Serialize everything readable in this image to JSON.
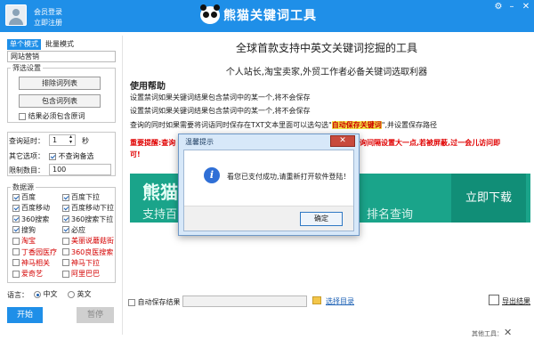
{
  "titlebar": {
    "login": "会员登录",
    "register": "立即注册",
    "app_title": "熊猫关键词工具",
    "controls": {
      "settings": "⚙",
      "minimize": "–",
      "close": "✕"
    }
  },
  "sidebar": {
    "tabs": [
      "单个模式",
      "批量模式"
    ],
    "keyword_input": "网站营销",
    "filter_group": {
      "label": "筛选设置",
      "exclude_button": "排除词列表",
      "include_button": "包含词列表",
      "must_include_label": "结果必须包含原词"
    },
    "interval_label": "查询延时：",
    "interval_value": "1",
    "interval_unit": "秒",
    "other_label": "其它选项：",
    "no_repeat_label": "不查询备选",
    "limit_label": "限制数目：",
    "limit_value": "100",
    "datasource": {
      "label": "数据源",
      "items": [
        {
          "label": "百度",
          "checked": true,
          "red": false
        },
        {
          "label": "百度下拉",
          "checked": true,
          "red": false
        },
        {
          "label": "百度移动",
          "checked": true,
          "red": false
        },
        {
          "label": "百度移动下拉",
          "checked": true,
          "red": false
        },
        {
          "label": "360搜索",
          "checked": true,
          "red": false
        },
        {
          "label": "360搜索下拉",
          "checked": true,
          "red": false
        },
        {
          "label": "搜狗",
          "checked": true,
          "red": false
        },
        {
          "label": "必应",
          "checked": true,
          "red": false
        },
        {
          "label": "淘宝",
          "checked": false,
          "red": true
        },
        {
          "label": "美丽说蘑菇街",
          "checked": false,
          "red": true
        },
        {
          "label": "丁香园医疗",
          "checked": false,
          "red": true
        },
        {
          "label": "360良医搜索",
          "checked": false,
          "red": true
        },
        {
          "label": "神马相关",
          "checked": false,
          "red": true
        },
        {
          "label": "神马下拉",
          "checked": false,
          "red": true
        },
        {
          "label": "爱奇艺",
          "checked": false,
          "red": true
        },
        {
          "label": "阿里巴巴",
          "checked": false,
          "red": true
        }
      ]
    },
    "language_label": "语言：",
    "lang_cn": "中文",
    "lang_en": "英文",
    "start_button": "开始",
    "pause_button": "暂停"
  },
  "main": {
    "title": "全球首款支持中英文关键词挖掘的工具",
    "subtitle": "个人站长,淘宝卖家,外贸工作者必备关键词选取利器",
    "help_title": "使用帮助",
    "help_lines": [
      "设置禁词如果关键词结果包含禁词中的某一个,将不会保存",
      "设置禁词如果关键词结果包含禁词中的某一个,将不会保存"
    ],
    "help_line3_pre": "查询的同时如果需要将词语同时保存在TXT文本里面可以选勾选\"",
    "help_line3_highlight": "自动保存关键词",
    "help_line3_post": "\",并设置保存路径",
    "warning_1a": "重要提醒:查询",
    "warning_1b": "查询间隔设置大一点,若被屏蔽,过一会儿访问即",
    "warning_2": "可!",
    "banner": {
      "title": "熊猫",
      "line1": "支持百",
      "line2": "排名查询",
      "download": "立即下载"
    },
    "autosave_label": "自动保存结果",
    "choose_dir": "选择目录",
    "export": "导出结果",
    "other_tools": "其他工具："
  },
  "dialog": {
    "title": "温馨提示",
    "message": "看您已支付成功,请重新打开软件登陆！",
    "ok": "确定",
    "close": "✕"
  }
}
